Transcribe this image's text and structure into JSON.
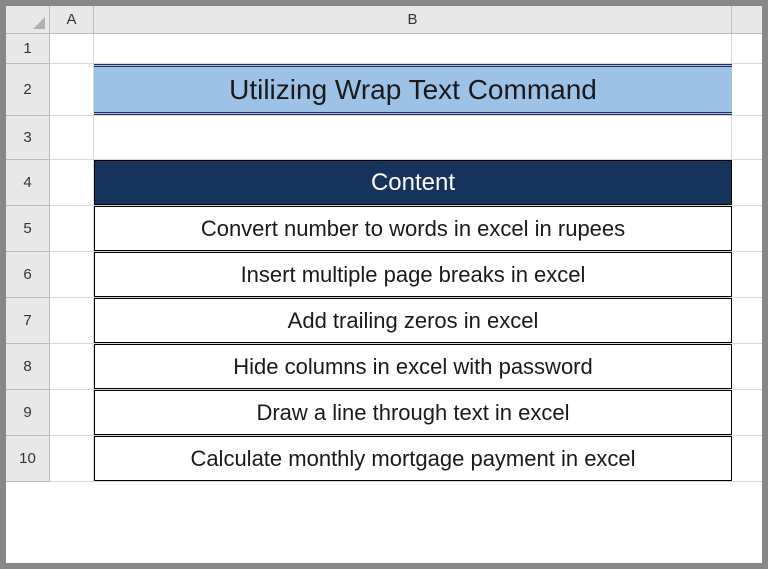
{
  "columns": {
    "A": "A",
    "B": "B"
  },
  "rowNumbers": [
    "1",
    "2",
    "3",
    "4",
    "5",
    "6",
    "7",
    "8",
    "9",
    "10"
  ],
  "title": "Utilizing Wrap Text Command",
  "tableHeader": "Content",
  "rows": [
    "Convert number to words in excel in rupees",
    "Insert multiple page breaks in excel",
    "Add trailing zeros in excel",
    "Hide columns in excel with password",
    "Draw a line through text in excel",
    "Calculate monthly mortgage payment in excel"
  ]
}
